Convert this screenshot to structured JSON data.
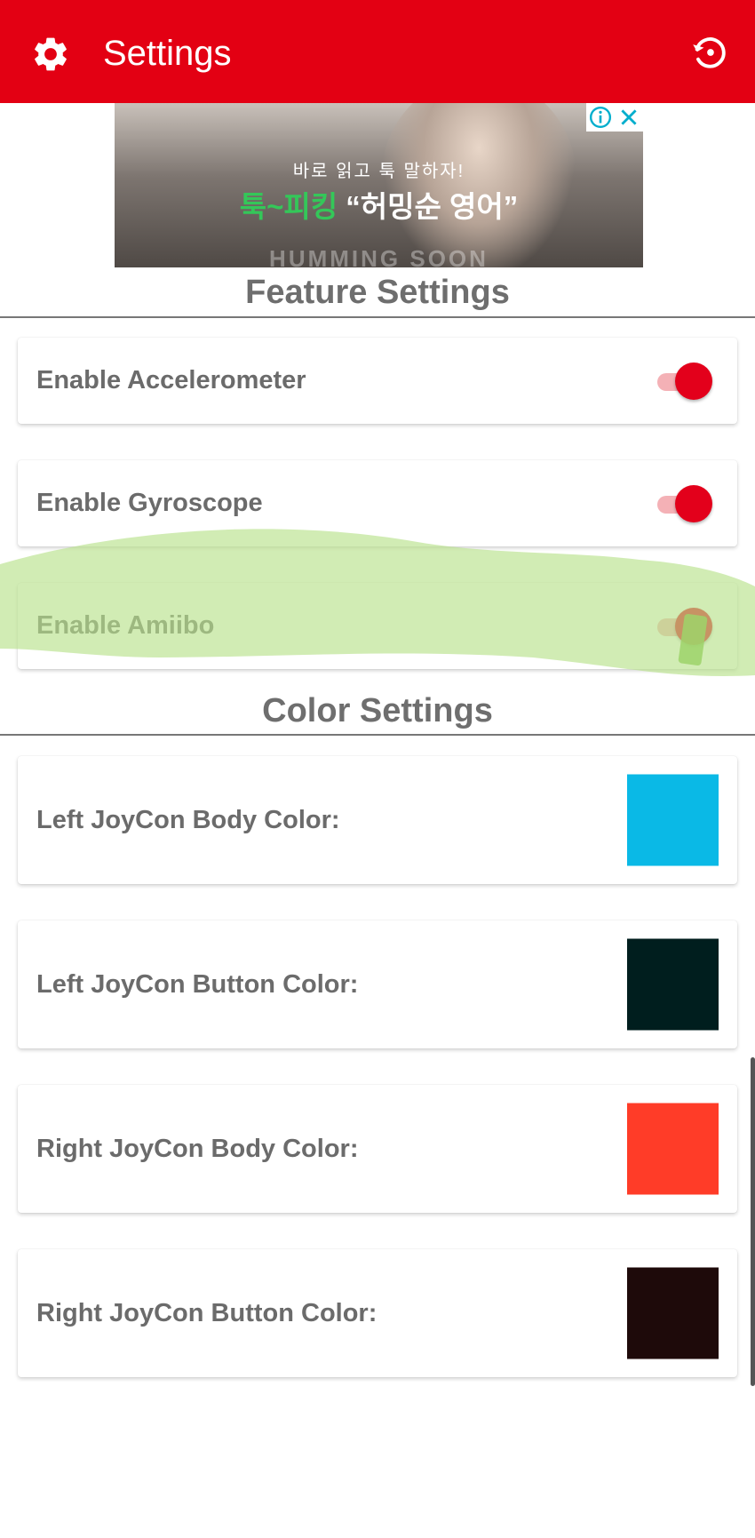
{
  "appbar": {
    "title": "Settings",
    "icons": {
      "left": "gear-icon",
      "right": "restore-icon"
    },
    "background": "#e30013"
  },
  "ad": {
    "line1": "바로 읽고 툭 말하자!",
    "line2_highlight": "툭~피킹",
    "line2_rest": " “허밍순 영어”",
    "brand": "HUMMING SOON",
    "badge_icons": [
      "info-icon",
      "close-icon"
    ]
  },
  "feature_settings": {
    "title": "Feature Settings",
    "items": [
      {
        "label": "Enable Accelerometer",
        "enabled": true
      },
      {
        "label": "Enable Gyroscope",
        "enabled": true
      },
      {
        "label": "Enable Amiibo",
        "enabled": true
      }
    ]
  },
  "color_settings": {
    "title": "Color Settings",
    "items": [
      {
        "label": "Left JoyCon Body Color:",
        "color": "#0ab9e6"
      },
      {
        "label": "Left JoyCon Button Color:",
        "color": "#001e1e"
      },
      {
        "label": "Right JoyCon Body Color:",
        "color": "#ff3c28"
      },
      {
        "label": "Right JoyCon Button Color:",
        "color": "#1e0a0a"
      }
    ]
  },
  "colors": {
    "accent": "#e3001b",
    "switch_track": "#f4b1b6",
    "label_text": "#6b6b6b",
    "highlight_marker": "#b9e28c"
  }
}
